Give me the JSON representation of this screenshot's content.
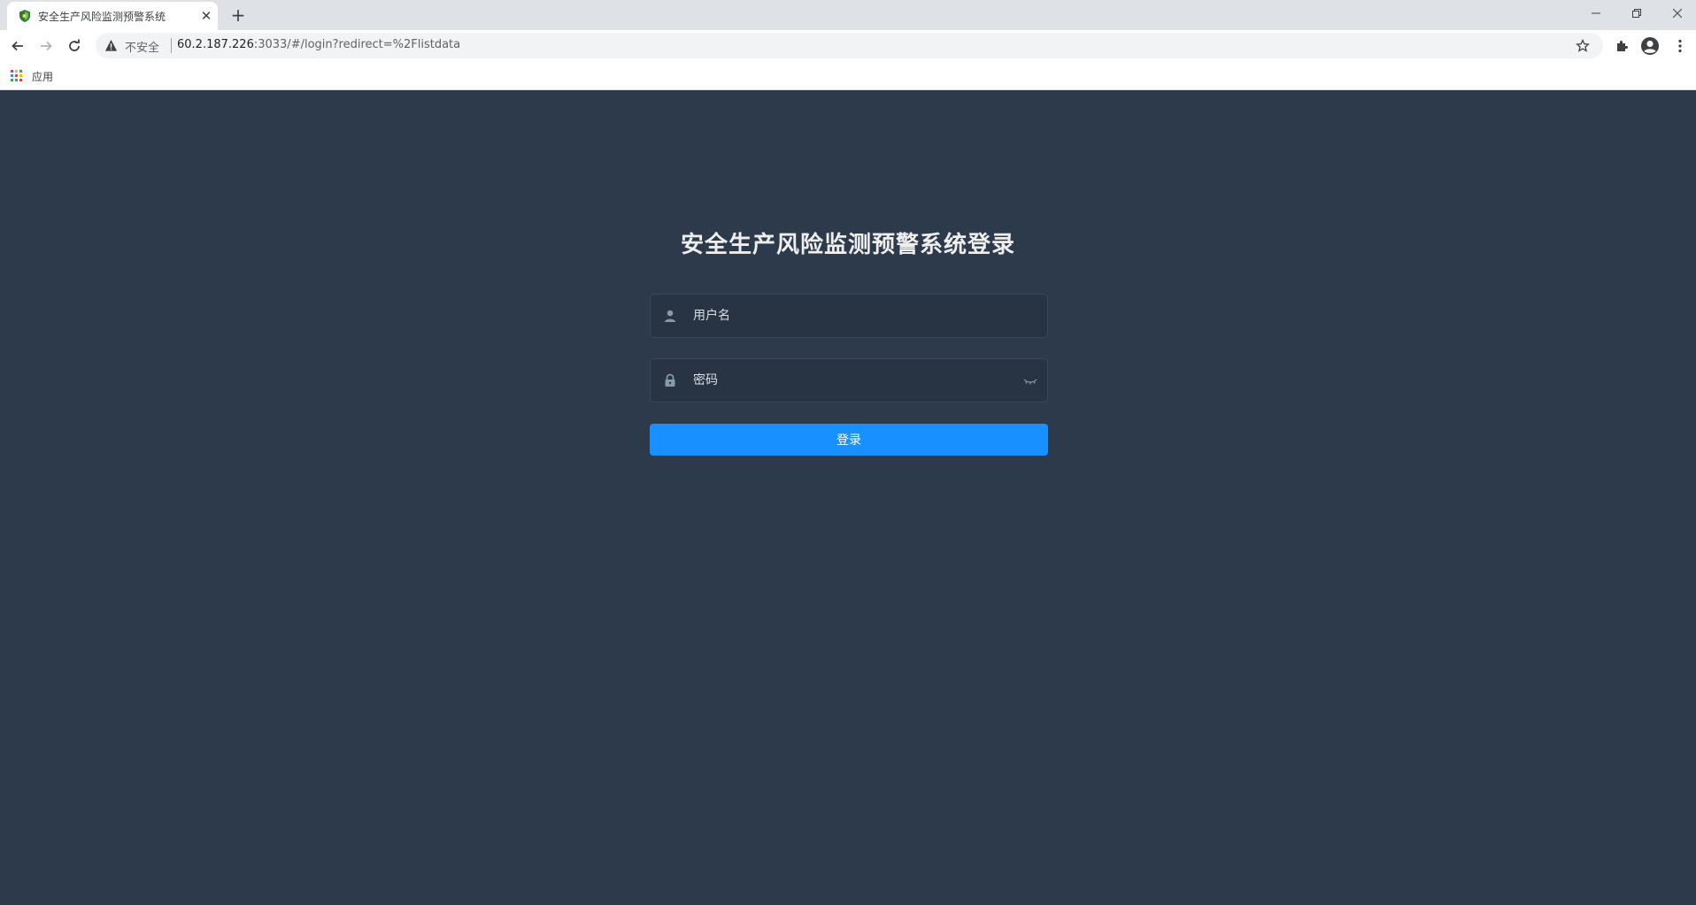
{
  "browser": {
    "tab": {
      "title": "安全生产风险监测预警系统",
      "favicon": "shield-icon"
    },
    "address_bar": {
      "security_label": "不安全",
      "url_host": "60.2.187.226",
      "url_rest": ":3033/#/login?redirect=%2Flistdata"
    },
    "bookmarks": {
      "apps_label": "应用"
    }
  },
  "login": {
    "title": "安全生产风险监测预警系统登录",
    "username": {
      "placeholder": "用户名",
      "value": "",
      "icon": "user-icon"
    },
    "password": {
      "placeholder": "密码",
      "value": "",
      "icon": "lock-icon",
      "toggle_icon": "eye-closed-icon"
    },
    "submit_label": "登录"
  },
  "colors": {
    "page_background": "#2d3a4b",
    "input_background": "#283443",
    "primary_button": "#1890ff",
    "title_text": "#eeeeee"
  }
}
